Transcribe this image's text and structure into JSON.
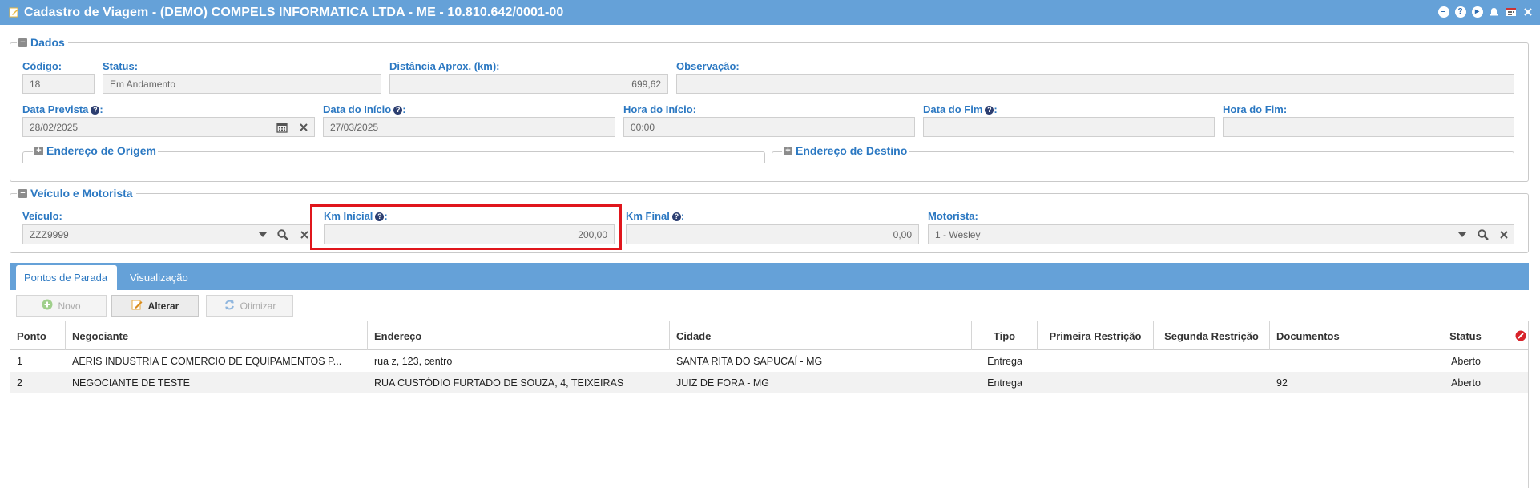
{
  "window": {
    "title": "Cadastro de Viagem - (DEMO) COMPELS INFORMATICA LTDA - ME - 10.810.642/0001-00"
  },
  "dados": {
    "legend": "Dados",
    "codigo_label": "Código:",
    "codigo_value": "18",
    "status_label": "Status:",
    "status_value": "Em Andamento",
    "distancia_label": "Distância Aprox. (km):",
    "distancia_value": "699,62",
    "observacao_label": "Observação:",
    "observacao_value": "",
    "data_prevista_label": "Data Prevista",
    "data_prevista_value": "28/02/2025",
    "data_inicio_label": "Data do Início",
    "data_inicio_value": "27/03/2025",
    "hora_inicio_label": "Hora do Início:",
    "hora_inicio_value": "00:00",
    "data_fim_label": "Data do Fim",
    "data_fim_value": "",
    "hora_fim_label": "Hora do Fim:",
    "hora_fim_value": "",
    "origem_legend": "Endereço de Origem",
    "destino_legend": "Endereço de Destino"
  },
  "veiculo": {
    "legend": "Veículo e Motorista",
    "veiculo_label": "Veículo:",
    "veiculo_value": "ZZZ9999",
    "km_inicial_label": "Km Inicial",
    "km_inicial_value": "200,00",
    "km_final_label": "Km Final",
    "km_final_value": "0,00",
    "motorista_label": "Motorista:",
    "motorista_value": "1 - Wesley"
  },
  "tabs": [
    {
      "label": "Pontos de Parada",
      "active": true
    },
    {
      "label": "Visualização",
      "active": false
    }
  ],
  "toolbar": {
    "novo": "Novo",
    "alterar": "Alterar",
    "otimizar": "Otimizar"
  },
  "grid": {
    "columns": [
      "Ponto",
      "Negociante",
      "Endereço",
      "Cidade",
      "Tipo",
      "Primeira Restrição",
      "Segunda Restrição",
      "Documentos",
      "Status"
    ],
    "rows": [
      [
        "1",
        "AERIS INDUSTRIA E COMERCIO DE EQUIPAMENTOS P...",
        "rua z, 123, centro",
        "SANTA RITA DO SAPUCAÍ - MG",
        "Entrega",
        "",
        "",
        "",
        "Aberto"
      ],
      [
        "2",
        "NEGOCIANTE DE TESTE",
        "RUA CUSTÓDIO FURTADO DE SOUZA, 4, TEIXEIRAS",
        "JUIZ DE FORA - MG",
        "Entrega",
        "",
        "",
        "92",
        "Aberto"
      ]
    ]
  },
  "colors": {
    "header_blue": "#65a1d8",
    "label_blue": "#2b78c2",
    "highlight_red": "#e0161c"
  }
}
